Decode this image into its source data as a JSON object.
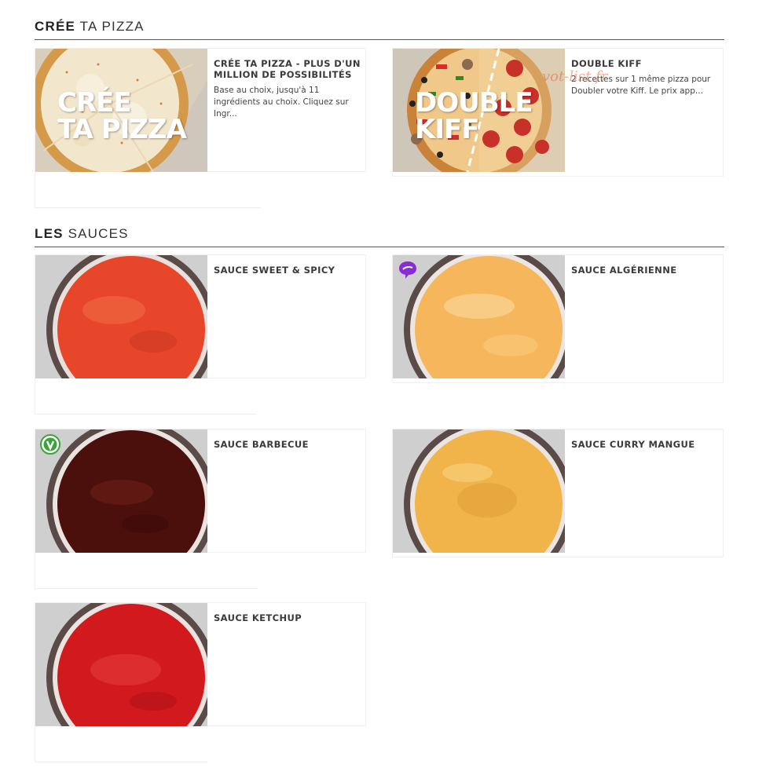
{
  "sections": [
    {
      "title_bold": "CRÉE",
      "title_light": "TA PIZZA"
    },
    {
      "title_bold": "LES",
      "title_light": "SAUCES"
    }
  ],
  "pizza_cards": [
    {
      "title": "CRÉE TA PIZZA - PLUS D'UN MILLION DE POSSIBILITÉS",
      "description": "Base au choix, jusqu'à 11 ingrédients au choix. Cliquez sur Ingr...",
      "image_text": [
        "CRÉE",
        "TA PIZZA"
      ]
    },
    {
      "title": "DOUBLE KIFF",
      "description": "2 recettes sur 1 même pizza pour Doubler votre Kiff. Le prix app...",
      "image_text": [
        "DOUBLE",
        "KIFF"
      ],
      "watermark": "vot-list.fr"
    }
  ],
  "sauce_cards": [
    {
      "title": "SAUCE SWEET & SPICY",
      "badge": "",
      "color": "#e8462a"
    },
    {
      "title": "SAUCE ALGÉRIENNE",
      "badge": "spicy-chat-icon",
      "color": "#f6b65c"
    },
    {
      "title": "SAUCE BARBECUE",
      "badge": "vegan-v-icon",
      "color": "#4b0f0c"
    },
    {
      "title": "SAUCE CURRY MANGUE",
      "badge": "",
      "color": "#f0b44a"
    },
    {
      "title": "SAUCE KETCHUP",
      "badge": "",
      "color": "#d21a1e"
    }
  ],
  "colors": {
    "badge_purple": "#8a2bd8",
    "badge_green": "#3aa33a",
    "bowl_rim": "#5a4a48",
    "bg_grey": "#cfcfcf"
  }
}
